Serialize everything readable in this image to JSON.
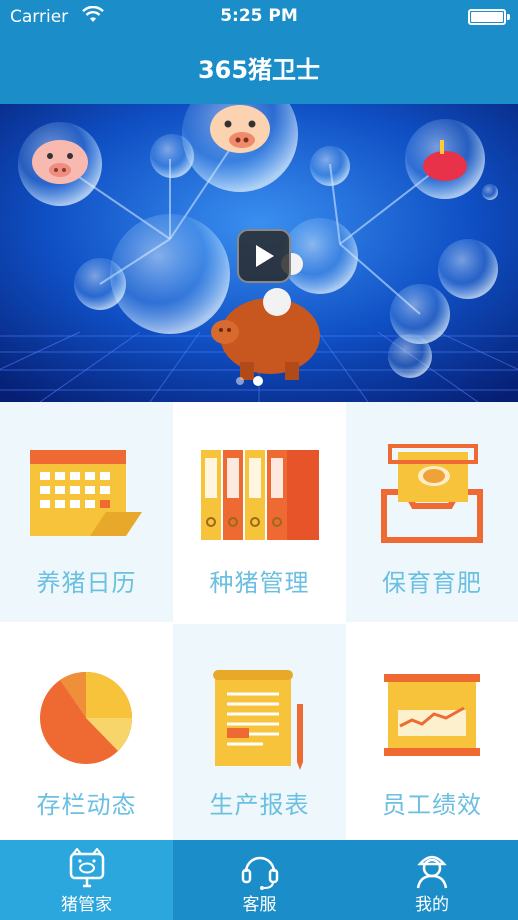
{
  "status_bar": {
    "carrier": "Carrier",
    "time": "5:25 PM"
  },
  "nav": {
    "title": "365猪卫士"
  },
  "banner": {
    "has_play_button": true,
    "page_indicator": {
      "count": 2,
      "active": 1
    }
  },
  "menu": [
    {
      "label": "养猪日历",
      "icon": "calendar-icon"
    },
    {
      "label": "种猪管理",
      "icon": "binders-icon"
    },
    {
      "label": "保育育肥",
      "icon": "pig-tray-icon"
    },
    {
      "label": "存栏动态",
      "icon": "pie-chart-icon"
    },
    {
      "label": "生产报表",
      "icon": "report-scroll-icon"
    },
    {
      "label": "员工绩效",
      "icon": "presentation-board-icon"
    }
  ],
  "tabbar": {
    "items": [
      {
        "label": "猪管家",
        "icon": "pig-home-icon",
        "active": true
      },
      {
        "label": "客服",
        "icon": "headset-icon",
        "active": false
      },
      {
        "label": "我的",
        "icon": "user-icon",
        "active": false
      }
    ]
  },
  "colors": {
    "primary": "#1b8ec9",
    "tab_active": "#2ca7dd",
    "label": "#6bbfe0",
    "cell_alt": "#eef8fc"
  }
}
